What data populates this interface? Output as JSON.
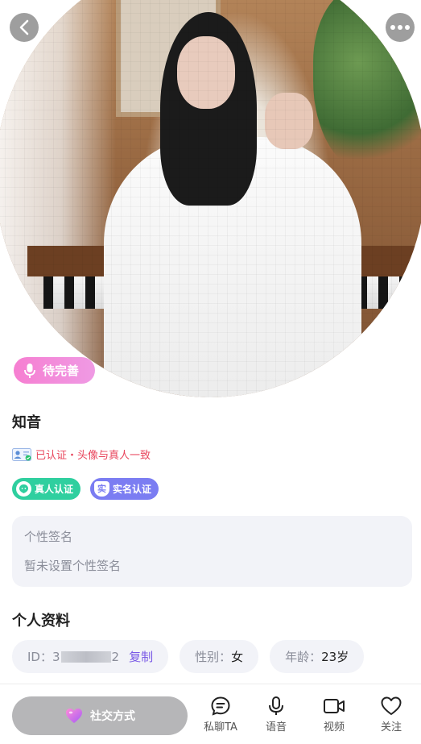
{
  "hero": {
    "voice_badge_label": "待完善"
  },
  "profile": {
    "name": "知音",
    "verify_text": "已认证・头像与真人一致",
    "badges": [
      {
        "label": "真人认证",
        "icon": "face-verify-icon",
        "color": "#2fcf9f"
      },
      {
        "label": "实名认证",
        "icon": "shield-real-icon",
        "color": "#7b7df2"
      }
    ],
    "signature": {
      "title": "个性签名",
      "text": "暂未设置个性签名"
    }
  },
  "info": {
    "section_title": "个人资料",
    "id_prefix": "ID：3",
    "id_suffix": "2",
    "copy_label": "复制",
    "gender_label": "性别：",
    "gender_value": "女",
    "age_label": "年龄：",
    "age_value": "23岁"
  },
  "bottom_bar": {
    "social_label": "社交方式",
    "tabs": [
      {
        "label": "私聊TA",
        "icon": "chat-bubble-icon"
      },
      {
        "label": "语音",
        "icon": "microphone-icon"
      },
      {
        "label": "视频",
        "icon": "video-camera-icon"
      },
      {
        "label": "关注",
        "icon": "heart-outline-icon"
      }
    ]
  },
  "colors": {
    "accent_pink": "#f67fd1",
    "verify_red": "#e8455c",
    "copy_purple": "#7a5ae6",
    "card_bg": "#f2f3f8"
  }
}
